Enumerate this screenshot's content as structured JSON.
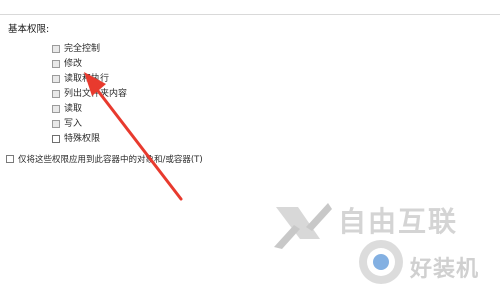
{
  "section": {
    "title": "基本权限:"
  },
  "permissions": [
    {
      "label": "完全控制",
      "checked": false,
      "enabled": false
    },
    {
      "label": "修改",
      "checked": false,
      "enabled": false
    },
    {
      "label": "读取和执行",
      "checked": false,
      "enabled": false
    },
    {
      "label": "列出文件夹内容",
      "checked": false,
      "enabled": false
    },
    {
      "label": "读取",
      "checked": false,
      "enabled": false
    },
    {
      "label": "写入",
      "checked": false,
      "enabled": false
    },
    {
      "label": "特殊权限",
      "checked": false,
      "enabled": true
    }
  ],
  "apply_option": {
    "label": "仅将这些权限应用到此容器中的对象和/或容器(T)",
    "checked": false
  },
  "watermark": {
    "brand_text": "自由互联",
    "secondary_text": "好装机"
  },
  "colors": {
    "arrow": "#e83a2e",
    "badge_accent": "#4f8fd6"
  }
}
